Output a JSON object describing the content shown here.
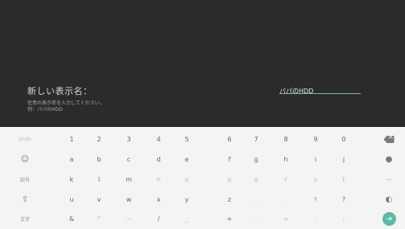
{
  "dialog": {
    "label": "新しい表示名：",
    "hint_line1": "任意の表示名を入力してください。",
    "hint_line2": "例：パパのHDD",
    "input_value": "パパのHDD"
  },
  "keyboard": {
    "rows": [
      [
        "Undo",
        "1",
        "2",
        "3",
        "4",
        "5",
        "6",
        "7",
        "8",
        "9",
        "0",
        "⌫"
      ],
      [
        "☺",
        "a",
        "b",
        "c",
        "d",
        "e",
        "f",
        "g",
        "h",
        "i",
        "j",
        "●"
      ],
      [
        "記号",
        "k",
        "l",
        "m",
        "n",
        "o",
        "p",
        "q",
        "r",
        "s",
        "t",
        "—"
      ],
      [
        "⇧",
        "u",
        "v",
        "w",
        "x",
        "y",
        "z",
        ",",
        ".",
        "!",
        "?",
        "◐"
      ],
      [
        "文字",
        "&",
        "^",
        "~",
        "/",
        "_",
        "+",
        "-",
        "=",
        ":",
        ";",
        "⇥"
      ]
    ]
  }
}
